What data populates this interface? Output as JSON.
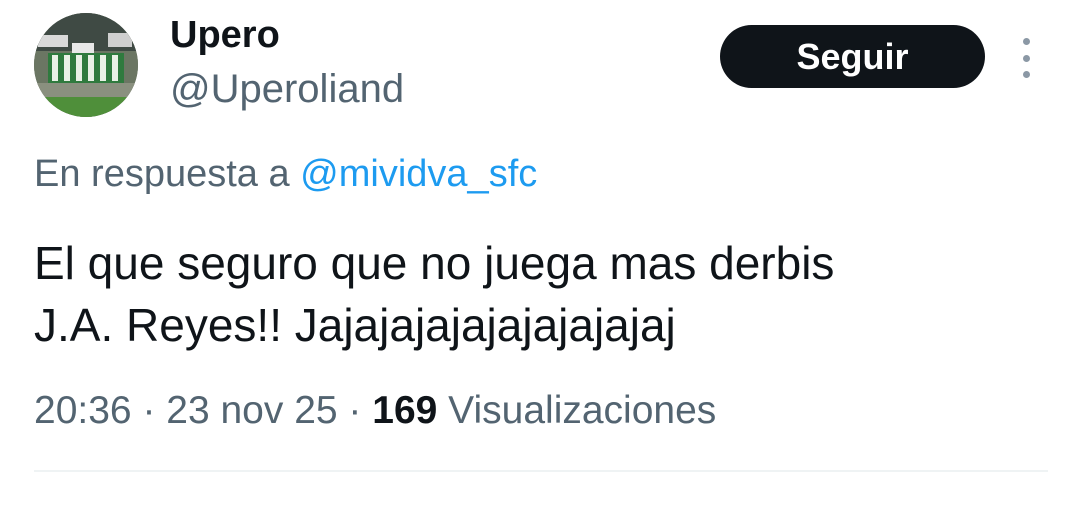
{
  "author": {
    "display_name": "Upero",
    "handle": "@Uperoliand"
  },
  "follow_button": {
    "label": "Seguir"
  },
  "more_icon": "more-vertical-icon",
  "reply": {
    "prefix": "En respuesta a ",
    "mention": "@mividva_sfc"
  },
  "tweet": {
    "line1": "El que seguro que no juega mas derbis",
    "line2": "J.A. Reyes!! Jajajajajajajajajajaj"
  },
  "meta": {
    "time": "20:36",
    "sep1": " · ",
    "date": "23 nov 25",
    "sep2": " · ",
    "views_count": "169",
    "views_label": " Visualizaciones"
  },
  "colors": {
    "text": "#0f1419",
    "secondary": "#536471",
    "link": "#1d9bf0",
    "button_bg": "#0f1419",
    "divider": "#eff3f4"
  }
}
